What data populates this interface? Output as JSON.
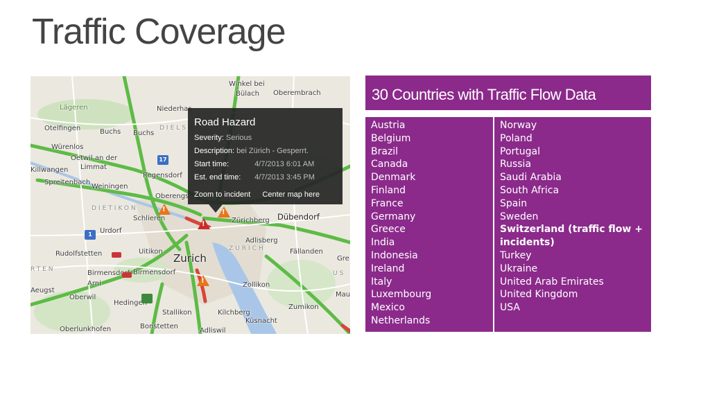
{
  "page": {
    "title": "Traffic Coverage"
  },
  "map": {
    "places": [
      {
        "name": "Winkel bei",
        "cls": ""
      },
      {
        "name": "Bülach",
        "cls": ""
      },
      {
        "name": "Oberembrach",
        "cls": ""
      },
      {
        "name": "Lägeren",
        "cls": "green"
      },
      {
        "name": "Niederhas",
        "cls": ""
      },
      {
        "name": "Otelfingen",
        "cls": ""
      },
      {
        "name": "Buchs",
        "cls": ""
      },
      {
        "name": "Buchs",
        "cls": ""
      },
      {
        "name": "DIELSD",
        "cls": "faint"
      },
      {
        "name": "Würenlos",
        "cls": ""
      },
      {
        "name": "Oetwil an der",
        "cls": ""
      },
      {
        "name": "Limmat",
        "cls": ""
      },
      {
        "name": "Killwangen",
        "cls": ""
      },
      {
        "name": "Spreitenbach",
        "cls": ""
      },
      {
        "name": "Regensdorf",
        "cls": ""
      },
      {
        "name": "Weiningen",
        "cls": ""
      },
      {
        "name": "Oberengs",
        "cls": ""
      },
      {
        "name": "DIETIKON",
        "cls": "faint"
      },
      {
        "name": "Schlieren",
        "cls": ""
      },
      {
        "name": "Zürichberg",
        "cls": ""
      },
      {
        "name": "Dübendorf",
        "cls": "mid"
      },
      {
        "name": "Urdorf",
        "cls": ""
      },
      {
        "name": "Adlisberg",
        "cls": ""
      },
      {
        "name": "ZURICH",
        "cls": "faint"
      },
      {
        "name": "Uitikon",
        "cls": ""
      },
      {
        "name": "Fällanden",
        "cls": ""
      },
      {
        "name": "Rudolfstetten",
        "cls": ""
      },
      {
        "name": "Zurich",
        "cls": "big"
      },
      {
        "name": "Gre",
        "cls": ""
      },
      {
        "name": "RTEN",
        "cls": "faint"
      },
      {
        "name": "Birmensdorf",
        "cls": ""
      },
      {
        "name": "Birmensdorf",
        "cls": ""
      },
      {
        "name": "US",
        "cls": "faint"
      },
      {
        "name": "Arni",
        "cls": ""
      },
      {
        "name": "Aeugst",
        "cls": ""
      },
      {
        "name": "Bonstetten",
        "cls": ""
      },
      {
        "name": "Stallikon",
        "cls": ""
      },
      {
        "name": "Kilchberg",
        "cls": ""
      },
      {
        "name": "Küsnacht",
        "cls": ""
      },
      {
        "name": "Oberwil",
        "cls": ""
      },
      {
        "name": "Zollikon",
        "cls": ""
      },
      {
        "name": "Zumikon",
        "cls": ""
      },
      {
        "name": "Mau",
        "cls": ""
      },
      {
        "name": "Oberlunkhofen",
        "cls": ""
      },
      {
        "name": "Adliswil",
        "cls": ""
      },
      {
        "name": "Hedingen",
        "cls": ""
      }
    ],
    "popup": {
      "title": "Road Hazard",
      "severity_label": "Severity:",
      "severity_value": "Serious",
      "description_label": "Description:",
      "description_value": "bei Zürich - Gesperrt.",
      "start_label": "Start time:",
      "start_value": "4/7/2013 6:01 AM",
      "end_label": "Est. end time:",
      "end_value": "4/7/2013 3:45 PM",
      "zoom_link": "Zoom to incident",
      "center_link": "Center map here"
    },
    "route_markers": [
      "17",
      "1"
    ]
  },
  "coverage": {
    "header": "30 Countries with Traffic Flow Data",
    "left_column": [
      "Austria",
      "Belgium",
      "Brazil",
      "Canada",
      "Denmark",
      "Finland",
      "France",
      "Germany",
      "Greece",
      "India",
      "Indonesia",
      "Ireland",
      "Italy",
      "Luxembourg",
      "Mexico",
      "Netherlands"
    ],
    "right_column": [
      "Norway",
      "Poland",
      "Portugal",
      "Russia",
      "Saudi Arabia",
      "South Africa",
      "Spain",
      "Sweden",
      "Switzerland (traffic flow + incidents)",
      "Turkey",
      "Ukraine",
      "United Arab Emirates",
      "United Kingdom",
      "USA"
    ],
    "highlighted": "Switzerland (traffic flow + incidents)"
  },
  "colors": {
    "accent_purple": "#8b2a8b",
    "map_road_green": "#5dbb46",
    "hazard_orange": "#e8751a",
    "lake_blue": "#a9c6e8"
  }
}
